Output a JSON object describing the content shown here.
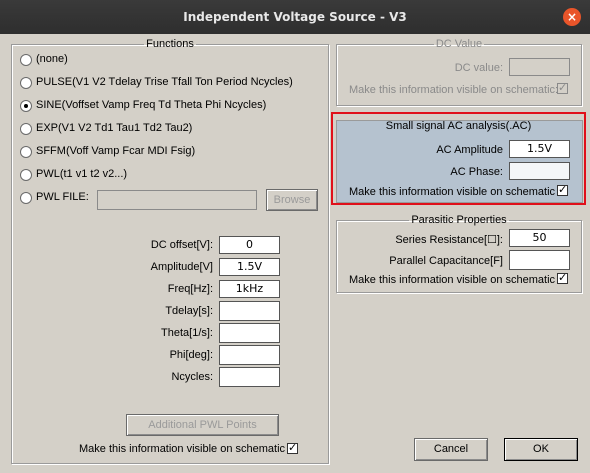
{
  "window": {
    "title": "Independent Voltage Source - V3",
    "close_glyph": "×"
  },
  "functions": {
    "legend": "Functions",
    "options": [
      {
        "label": "(none)",
        "checked": false
      },
      {
        "label": "PULSE(V1 V2 Tdelay Trise Tfall Ton Period Ncycles)",
        "checked": false
      },
      {
        "label": "SINE(Voffset Vamp Freq Td Theta Phi Ncycles)",
        "checked": true
      },
      {
        "label": "EXP(V1 V2 Td1 Tau1 Td2 Tau2)",
        "checked": false
      },
      {
        "label": "SFFM(Voff Vamp Fcar MDI Fsig)",
        "checked": false
      },
      {
        "label": "PWL(t1 v1 t2 v2...)",
        "checked": false
      },
      {
        "label": "PWL FILE:",
        "checked": false
      }
    ],
    "pwl_file_value": "",
    "browse_label": "Browse",
    "params": [
      {
        "label": "DC offset[V]:",
        "value": "0"
      },
      {
        "label": "Amplitude[V]",
        "value": "1.5V"
      },
      {
        "label": "Freq[Hz]:",
        "value": "1kHz"
      },
      {
        "label": "Tdelay[s]:",
        "value": ""
      },
      {
        "label": "Theta[1/s]:",
        "value": ""
      },
      {
        "label": "Phi[deg]:",
        "value": ""
      },
      {
        "label": "Ncycles:",
        "value": ""
      }
    ],
    "additional_pwl_label": "Additional PWL Points",
    "visible_label": "Make this information visible on schematic",
    "visible_checked": true
  },
  "dc_value": {
    "legend": "DC Value",
    "label": "DC value:",
    "value": "",
    "visible_label": "Make this information visible on schematic:",
    "visible_checked": true
  },
  "ac": {
    "legend": "Small signal AC analysis(.AC)",
    "amplitude_label": "AC Amplitude",
    "amplitude_value": "1.5V",
    "phase_label": "AC Phase:",
    "phase_value": "",
    "visible_label": "Make this information visible on schematic",
    "visible_checked": true
  },
  "parasitic": {
    "legend": "Parasitic Properties",
    "series_label": "Series Resistance[☐]:",
    "series_value": "50",
    "parallel_label": "Parallel Capacitance[F]",
    "parallel_value": "",
    "visible_label": "Make this information visible on schematic",
    "visible_checked": true
  },
  "buttons": {
    "cancel": "Cancel",
    "ok": "OK"
  },
  "colors": {
    "highlight": "#e0101a",
    "ac_panel": "#b5c2cf",
    "close": "#e9552a"
  }
}
